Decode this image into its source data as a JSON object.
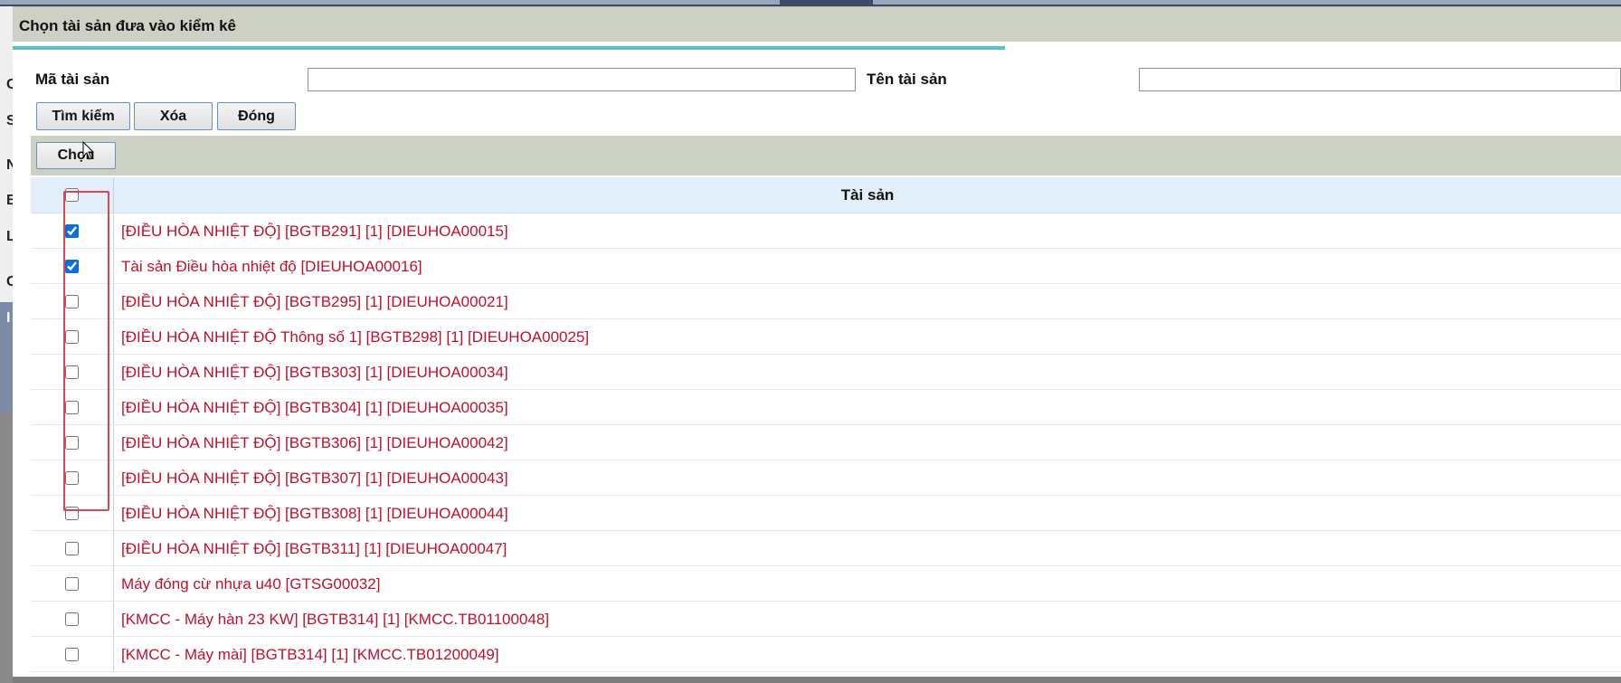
{
  "dialog": {
    "title": "Chọn tài sản đưa vào kiểm kê"
  },
  "background_page": {
    "labels": [
      "C",
      "S",
      "N",
      "B",
      "L",
      "C",
      "I"
    ]
  },
  "search": {
    "ma_label": "Mã tài sản",
    "ma_value": "",
    "ten_label": "Tên tài sản",
    "ten_value": ""
  },
  "buttons": {
    "search": "Tìm kiếm",
    "clear": "Xóa",
    "close": "Đóng",
    "select": "Chọn"
  },
  "table": {
    "header": "Tài sản",
    "header_checked": false,
    "rows": [
      {
        "text": "[ĐIỀU HÒA NHIỆT ĐỘ] [BGTB291] [1] [DIEUHOA00015]",
        "checked": true
      },
      {
        "text": "Tài sản Điều hòa nhiệt độ [DIEUHOA00016]",
        "checked": true
      },
      {
        "text": "[ĐIỀU HÒA NHIỆT ĐỘ] [BGTB295] [1] [DIEUHOA00021]",
        "checked": false
      },
      {
        "text": "[ĐIỀU HÒA NHIỆT ĐỘ Thông số 1] [BGTB298] [1] [DIEUHOA00025]",
        "checked": false
      },
      {
        "text": "[ĐIỀU HÒA NHIỆT ĐỘ] [BGTB303] [1] [DIEUHOA00034]",
        "checked": false
      },
      {
        "text": "[ĐIỀU HÒA NHIỆT ĐỘ] [BGTB304] [1] [DIEUHOA00035]",
        "checked": false
      },
      {
        "text": "[ĐIỀU HÒA NHIỆT ĐỘ] [BGTB306] [1] [DIEUHOA00042]",
        "checked": false
      },
      {
        "text": "[ĐIỀU HÒA NHIỆT ĐỘ] [BGTB307] [1] [DIEUHOA00043]",
        "checked": false
      },
      {
        "text": "[ĐIỀU HÒA NHIỆT ĐỘ] [BGTB308] [1] [DIEUHOA00044]",
        "checked": false
      },
      {
        "text": "[ĐIỀU HÒA NHIỆT ĐỘ] [BGTB311] [1] [DIEUHOA00047]",
        "checked": false
      },
      {
        "text": "Máy đóng cừ nhựa u40 [GTSG00032]",
        "checked": false
      },
      {
        "text": "[KMCC - Máy hàn 23 KW] [BGTB314] [1] [KMCC.TB01100048]",
        "checked": false
      },
      {
        "text": "[KMCC - Máy mài] [BGTB314] [1] [KMCC.TB01200049]",
        "checked": false
      }
    ]
  },
  "colors": {
    "title_bar": "#cdd1c4",
    "progress": "#5bc0c9",
    "header_bg": "#e2effb",
    "row_text": "#c0102c",
    "highlight_box": "#d8484e"
  }
}
